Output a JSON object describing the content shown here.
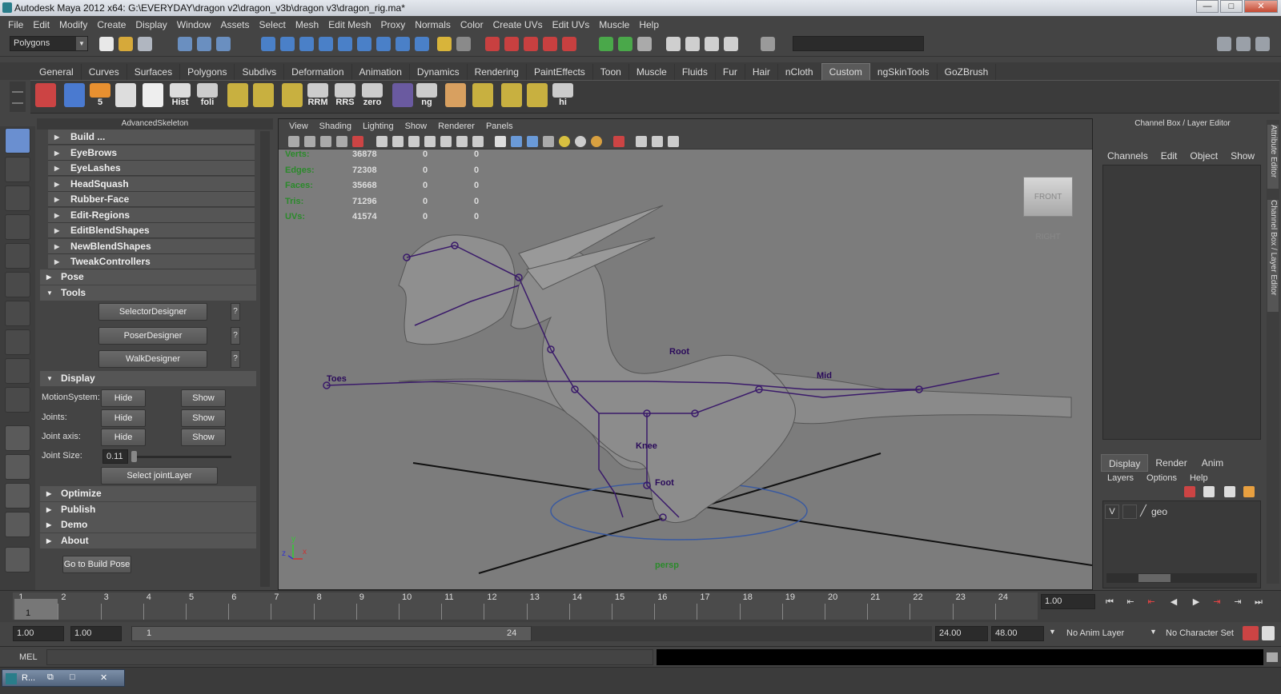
{
  "window": {
    "title": "Autodesk Maya 2012 x64: G:\\EVERYDAY\\dragon v2\\dragon_v3b\\dragon v3\\dragon_rig.ma*",
    "min": "—",
    "max": "□",
    "close": "✕"
  },
  "menubar": [
    "File",
    "Edit",
    "Modify",
    "Create",
    "Display",
    "Window",
    "Assets",
    "Select",
    "Mesh",
    "Edit Mesh",
    "Proxy",
    "Normals",
    "Color",
    "Create UVs",
    "Edit UVs",
    "Muscle",
    "Help"
  ],
  "statusline": {
    "mode": "Polygons"
  },
  "shelf_tabs": [
    "General",
    "Curves",
    "Surfaces",
    "Polygons",
    "Subdivs",
    "Deformation",
    "Animation",
    "Dynamics",
    "Rendering",
    "PaintEffects",
    "Toon",
    "Muscle",
    "Fluids",
    "Fur",
    "Hair",
    "nCloth",
    "Custom",
    "ngSkinTools",
    "GoZBrush"
  ],
  "shelf_active": "Custom",
  "shelf_buttons": [
    {
      "label": "",
      "icon": "paint-brush-icon"
    },
    {
      "label": "",
      "icon": "cone-icon"
    },
    {
      "label": "5",
      "icon": "five-circle-icon"
    },
    {
      "label": "",
      "icon": "t-pose-icon"
    },
    {
      "label": "",
      "icon": "skull-icon"
    },
    {
      "label": "Hist",
      "icon": "history-icon"
    },
    {
      "label": "foli",
      "icon": "foli-icon"
    },
    {
      "label": "",
      "icon": "grid-icon"
    },
    {
      "label": "",
      "icon": "grid2-icon"
    },
    {
      "label": "",
      "icon": "uv-icon"
    },
    {
      "label": "RRM",
      "icon": "rrm-icon"
    },
    {
      "label": "RRS",
      "icon": "rrs-icon"
    },
    {
      "label": "zero",
      "icon": "zero-icon"
    },
    {
      "label": "",
      "icon": "joint-icon"
    },
    {
      "label": "ng",
      "icon": "ng-icon"
    },
    {
      "label": "",
      "icon": "face-icon"
    },
    {
      "label": "",
      "icon": "plane-icon"
    },
    {
      "label": "",
      "icon": "uv2-icon"
    },
    {
      "label": "",
      "icon": "uv3-icon"
    },
    {
      "label": "hi",
      "icon": "hi-icon"
    }
  ],
  "left_panel": {
    "title": "AdvancedSkeleton",
    "build_items": [
      "Build ...",
      "EyeBrows",
      "EyeLashes",
      "HeadSquash",
      "Rubber-Face",
      "Edit-Regions",
      "EditBlendShapes",
      "NewBlendShapes",
      "TweakControllers"
    ],
    "pose": "Pose",
    "tools": "Tools",
    "tool_buttons": [
      "SelectorDesigner",
      "PoserDesigner",
      "WalkDesigner"
    ],
    "help": "?",
    "display": "Display",
    "rows": [
      {
        "label": "MotionSystem:",
        "hide": "Hide",
        "show": "Show"
      },
      {
        "label": "Joints:",
        "hide": "Hide",
        "show": "Show"
      },
      {
        "label": "Joint axis:",
        "hide": "Hide",
        "show": "Show"
      }
    ],
    "joint_size_label": "Joint Size:",
    "joint_size": "0.11",
    "select_joint_layer": "Select jointLayer",
    "sections": [
      "Optimize",
      "Publish",
      "Demo",
      "About"
    ],
    "go_to_build": "Go to Build Pose"
  },
  "viewport": {
    "menu": [
      "View",
      "Shading",
      "Lighting",
      "Show",
      "Renderer",
      "Panels"
    ],
    "hud": [
      {
        "label": "Verts:",
        "v": "36878",
        "a": "0",
        "b": "0"
      },
      {
        "label": "Edges:",
        "v": "72308",
        "a": "0",
        "b": "0"
      },
      {
        "label": "Faces:",
        "v": "35668",
        "a": "0",
        "b": "0"
      },
      {
        "label": "Tris:",
        "v": "71296",
        "a": "0",
        "b": "0"
      },
      {
        "label": "UVs:",
        "v": "41574",
        "a": "0",
        "b": "0"
      }
    ],
    "cube_front": "FRONT",
    "cube_right": "RIGHT",
    "camera": "persp",
    "rig_labels": [
      "Root",
      "Mid",
      "Toes",
      "Foot",
      "Knee"
    ]
  },
  "right_panel": {
    "title": "Channel Box / Layer Editor",
    "menu": [
      "Channels",
      "Edit",
      "Object",
      "Show"
    ],
    "layer_tabs": [
      "Display",
      "Render",
      "Anim"
    ],
    "layer_menu": [
      "Layers",
      "Options",
      "Help"
    ],
    "layer": {
      "v": "V",
      "name": "geo"
    },
    "side_tabs": [
      "Attribute Editor",
      "Channel Box / Layer Editor"
    ]
  },
  "timeline": {
    "ticks": [
      "1",
      "2",
      "3",
      "4",
      "5",
      "6",
      "7",
      "8",
      "9",
      "10",
      "11",
      "12",
      "13",
      "14",
      "15",
      "16",
      "17",
      "18",
      "19",
      "20",
      "21",
      "22",
      "23",
      "24"
    ],
    "current_frame": "1",
    "current_time": "1.00"
  },
  "range": {
    "start": "1.00",
    "anim_start": "1.00",
    "range_start": "1",
    "range_end": "24",
    "anim_end": "24.00",
    "end": "48.00",
    "anim_layer": "No Anim Layer",
    "char_set": "No Character Set"
  },
  "mel": {
    "label": "MEL"
  },
  "taskbar": {
    "item": "R..."
  }
}
